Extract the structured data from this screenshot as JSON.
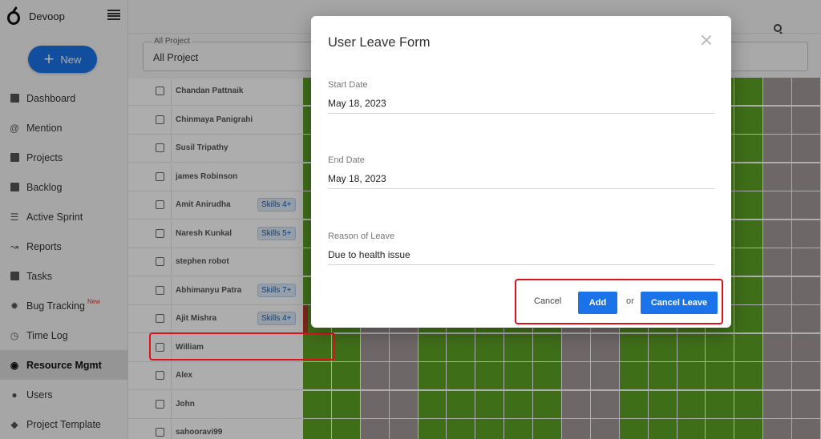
{
  "app": {
    "name": "Devoop"
  },
  "sidebar": {
    "new_label": "New",
    "items": [
      {
        "label": "Dashboard",
        "icon": "dashboard-icon"
      },
      {
        "label": "Mention",
        "icon": "at-icon"
      },
      {
        "label": "Projects",
        "icon": "briefcase-icon"
      },
      {
        "label": "Backlog",
        "icon": "backlog-icon"
      },
      {
        "label": "Active Sprint",
        "icon": "lines-icon"
      },
      {
        "label": "Reports",
        "icon": "chart-line-icon"
      },
      {
        "label": "Tasks",
        "icon": "checkbox-icon"
      },
      {
        "label": "Bug Tracking",
        "icon": "bug-icon",
        "badge": "New"
      },
      {
        "label": "Time Log",
        "icon": "clock-icon"
      },
      {
        "label": "Resource Mgmt",
        "icon": "resource-icon",
        "active": true
      },
      {
        "label": "Users",
        "icon": "user-icon"
      },
      {
        "label": "Project Template",
        "icon": "layers-icon"
      }
    ]
  },
  "filter": {
    "legend": "All Project",
    "value": "All Project"
  },
  "users": [
    {
      "name": "Chandan Pattnaik"
    },
    {
      "name": "Chinmaya Panigrahi"
    },
    {
      "name": "Susil Tripathy"
    },
    {
      "name": "james Robinson"
    },
    {
      "name": "Amit Anirudha",
      "skills": "Skills 4+"
    },
    {
      "name": "Naresh Kunkal",
      "skills": "Skills 5+"
    },
    {
      "name": "stephen robot"
    },
    {
      "name": "Abhimanyu Patra",
      "skills": "Skills 7+"
    },
    {
      "name": "Ajit Mishra",
      "skills": "Skills 4+"
    },
    {
      "name": "William"
    },
    {
      "name": "Alex"
    },
    {
      "name": "John"
    },
    {
      "name": "sahooravi99"
    }
  ],
  "colors": {
    "available": "#5ea226",
    "weekend": "#a39898",
    "leave": "#c0392b",
    "accent": "#1a73e8",
    "highlight": "#e0101a"
  },
  "calendar": {
    "day_columns": 18,
    "weekend_columns": [
      2,
      3,
      9,
      10,
      16,
      17
    ]
  },
  "modal": {
    "title": "User Leave Form",
    "start_date_label": "Start Date",
    "start_date_value": "May 18, 2023",
    "end_date_label": "End Date",
    "end_date_value": "May 18, 2023",
    "reason_label": "Reason of Leave",
    "reason_value": "Due to health issue",
    "cancel_label": "Cancel",
    "add_label": "Add",
    "or_label": "or",
    "cancel_leave_label": "Cancel Leave"
  }
}
